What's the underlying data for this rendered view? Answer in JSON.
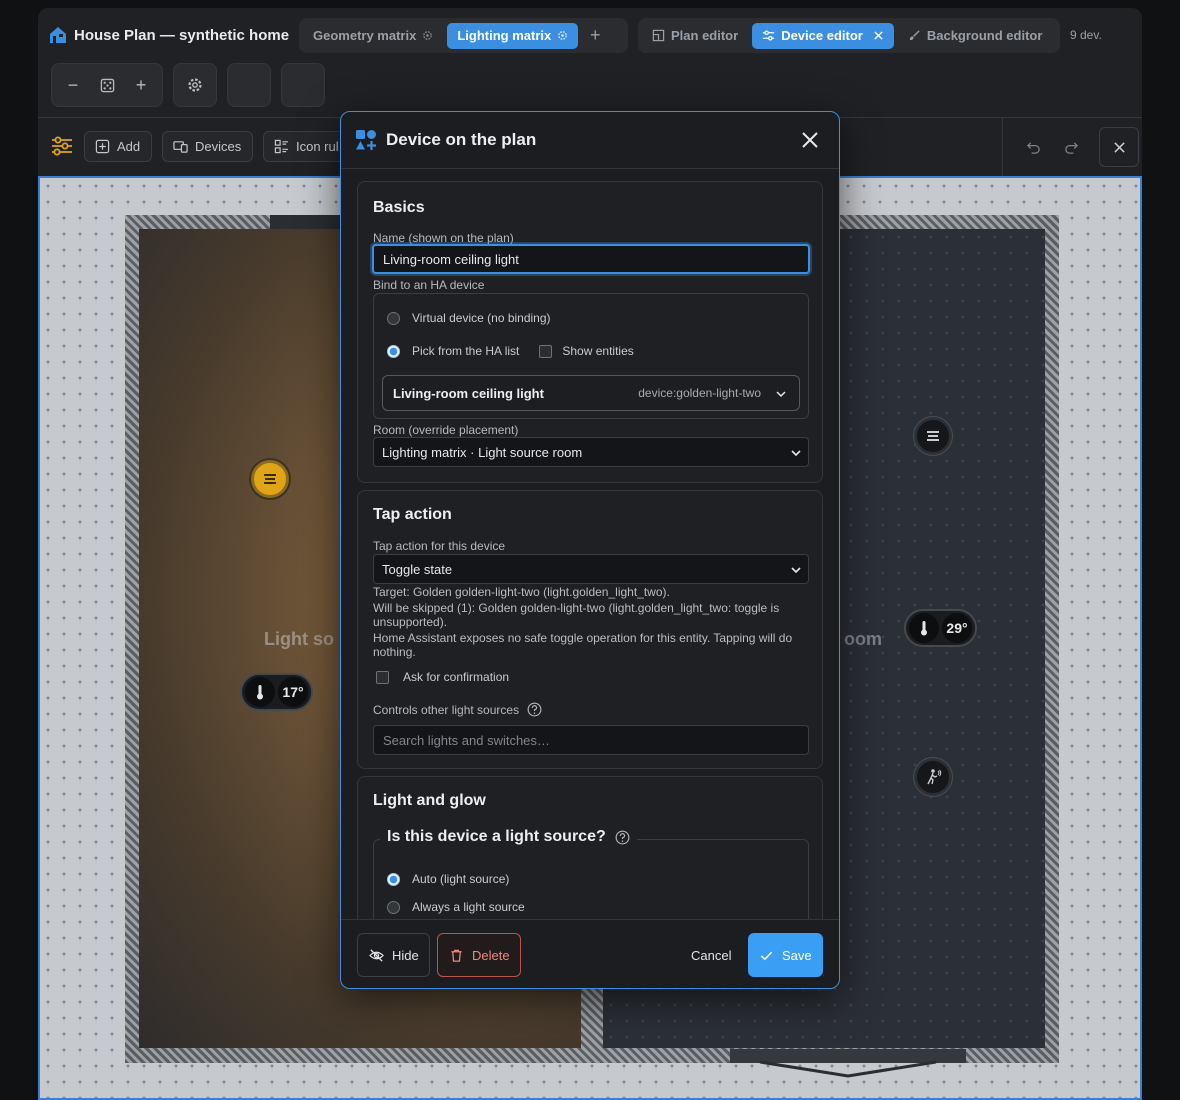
{
  "app": {
    "title": "House Plan — synthetic home",
    "tabs": [
      {
        "label": "Geometry matrix",
        "active": false
      },
      {
        "label": "Lighting matrix",
        "active": true
      }
    ],
    "add_tab_label": "+",
    "mode_tabs": [
      {
        "label": "Plan editor",
        "active": false
      },
      {
        "label": "Device editor",
        "active": true
      },
      {
        "label": "Background editor",
        "active": false
      }
    ],
    "device_count": "9 dev."
  },
  "toolbar": {
    "zoom_out": "−",
    "zoom_in": "+"
  },
  "edit_toolbar": {
    "add_label": "Add",
    "devices_label": "Devices",
    "icon_rules_label": "Icon rul"
  },
  "plan": {
    "left_room_label": "Light so",
    "right_room_label": "oom",
    "left_temp": "17°",
    "right_temp": "29°"
  },
  "modal": {
    "title": "Device on the plan",
    "basics": {
      "title": "Basics",
      "name_label": "Name (shown on the plan)",
      "name_value": "Living-room ceiling light",
      "bind_label": "Bind to an HA device",
      "virtual_option": "Virtual device (no binding)",
      "pick_option": "Pick from the HA list",
      "show_entities": "Show entities",
      "ha_device_name": "Living-room ceiling light",
      "ha_device_id": "device:golden-light-two",
      "room_label": "Room (override placement)",
      "room_value": "Lighting matrix · Light source room"
    },
    "tap": {
      "title": "Tap action",
      "action_label": "Tap action for this device",
      "action_value": "Toggle state",
      "target_note": "Target: Golden golden-light-two (light.golden_light_two).",
      "skip_note": "Will be skipped (1): Golden golden-light-two (light.golden_light_two: toggle is unsupported).",
      "ha_note": "Home Assistant exposes no safe toggle operation for this entity. Tapping will do nothing.",
      "confirm_label": "Ask for confirmation",
      "controls_label": "Controls other light sources",
      "search_placeholder": "Search lights and switches…"
    },
    "light": {
      "title": "Light and glow",
      "question": "Is this device a light source?",
      "auto_option": "Auto (light source)",
      "always_option": "Always a light source"
    },
    "footer": {
      "hide": "Hide",
      "delete": "Delete",
      "cancel": "Cancel",
      "save": "Save"
    }
  },
  "colors": {
    "accent": "#3a8fe0",
    "save": "#3a9ef5",
    "delete": "#f08a80",
    "marker_gold": "#e0a516"
  }
}
